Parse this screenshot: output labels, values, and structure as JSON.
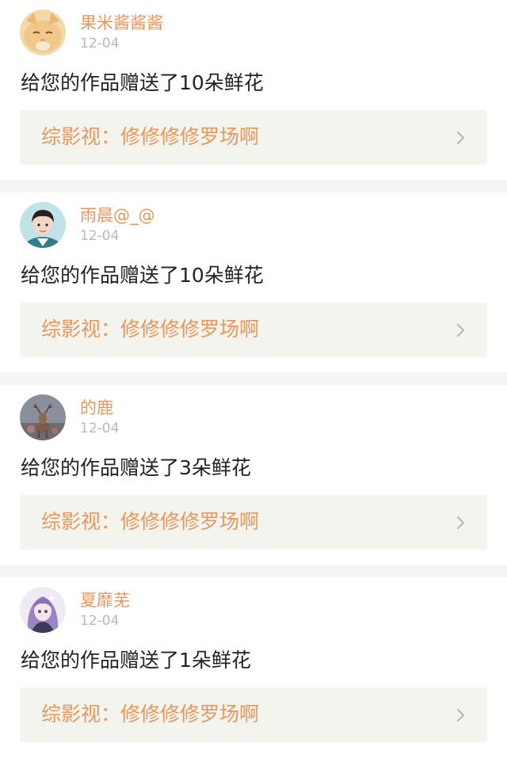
{
  "notifications": [
    {
      "avatar_icon": "kitten-avatar-icon",
      "username": "果米酱酱酱",
      "date": "12-04",
      "message": "给您的作品赠送了10朵鲜花",
      "work_label": "综影视：",
      "work_title": "修修修修罗场啊"
    },
    {
      "avatar_icon": "person-avatar-icon",
      "username": "雨晨@_@",
      "date": "12-04",
      "message": "给您的作品赠送了10朵鲜花",
      "work_label": "综影视：",
      "work_title": "修修修修罗场啊"
    },
    {
      "avatar_icon": "deer-avatar-icon",
      "username": "的鹿",
      "date": "12-04",
      "message": "给您的作品赠送了3朵鲜花",
      "work_label": "综影视：",
      "work_title": "修修修修罗场啊"
    },
    {
      "avatar_icon": "anime-girl-avatar-icon",
      "username": "夏靡芜",
      "date": "12-04",
      "message": "给您的作品赠送了1朵鲜花",
      "work_label": "综影视：",
      "work_title": "修修修修罗场啊"
    }
  ],
  "colors": {
    "accent": "#e8965c",
    "date": "#b8b8b8",
    "text": "#222222",
    "link_background": "#f4f4ee",
    "separator": "#f5f5f5"
  }
}
